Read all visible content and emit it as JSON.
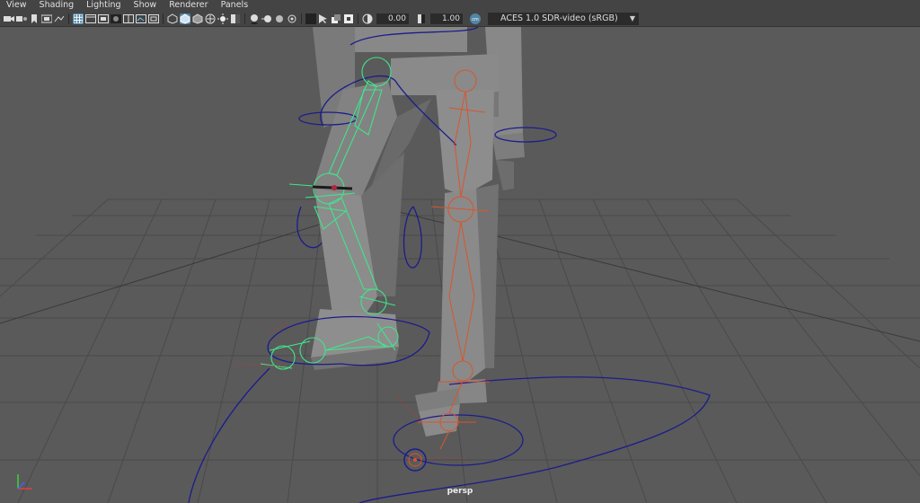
{
  "menubar": {
    "items": [
      {
        "label": "View"
      },
      {
        "label": "Shading"
      },
      {
        "label": "Lighting"
      },
      {
        "label": "Show"
      },
      {
        "label": "Renderer"
      },
      {
        "label": "Panels"
      }
    ]
  },
  "toolbar": {
    "exposure_value": "0.00",
    "gamma_value": "1.00",
    "color_space": "ACES 1.0 SDR-video (sRGB)"
  },
  "viewport": {
    "camera_label": "persp"
  },
  "colors": {
    "viewport_bg": "#5a5a5a",
    "selected_joint": "#3fe68a",
    "unselected_joint": "#d9552b",
    "control_curve": "#1c1c8c",
    "accent": "#5285a6"
  },
  "icons": [
    "camera-icon",
    "camera-attributes-icon",
    "bookmark-icon",
    "film-icon",
    "image-plane-icon",
    "grid-icon",
    "film-gate-icon",
    "resolution-gate-icon",
    "gate-mask-icon",
    "field-chart-icon",
    "safe-action-icon",
    "safe-title-icon",
    "wireframe-icon",
    "smooth-shade-icon",
    "bounding-box-icon",
    "textured-icon",
    "lights-icon",
    "shadows-icon",
    "screen-space-ao-icon",
    "motion-blur-icon",
    "anti-alias-icon",
    "depth-of-field-icon",
    "isolate-select-icon",
    "xray-icon",
    "xray-active-icon",
    "xray-joints-icon",
    "gamma-icon",
    "exposure-icon",
    "color-management-icon"
  ]
}
